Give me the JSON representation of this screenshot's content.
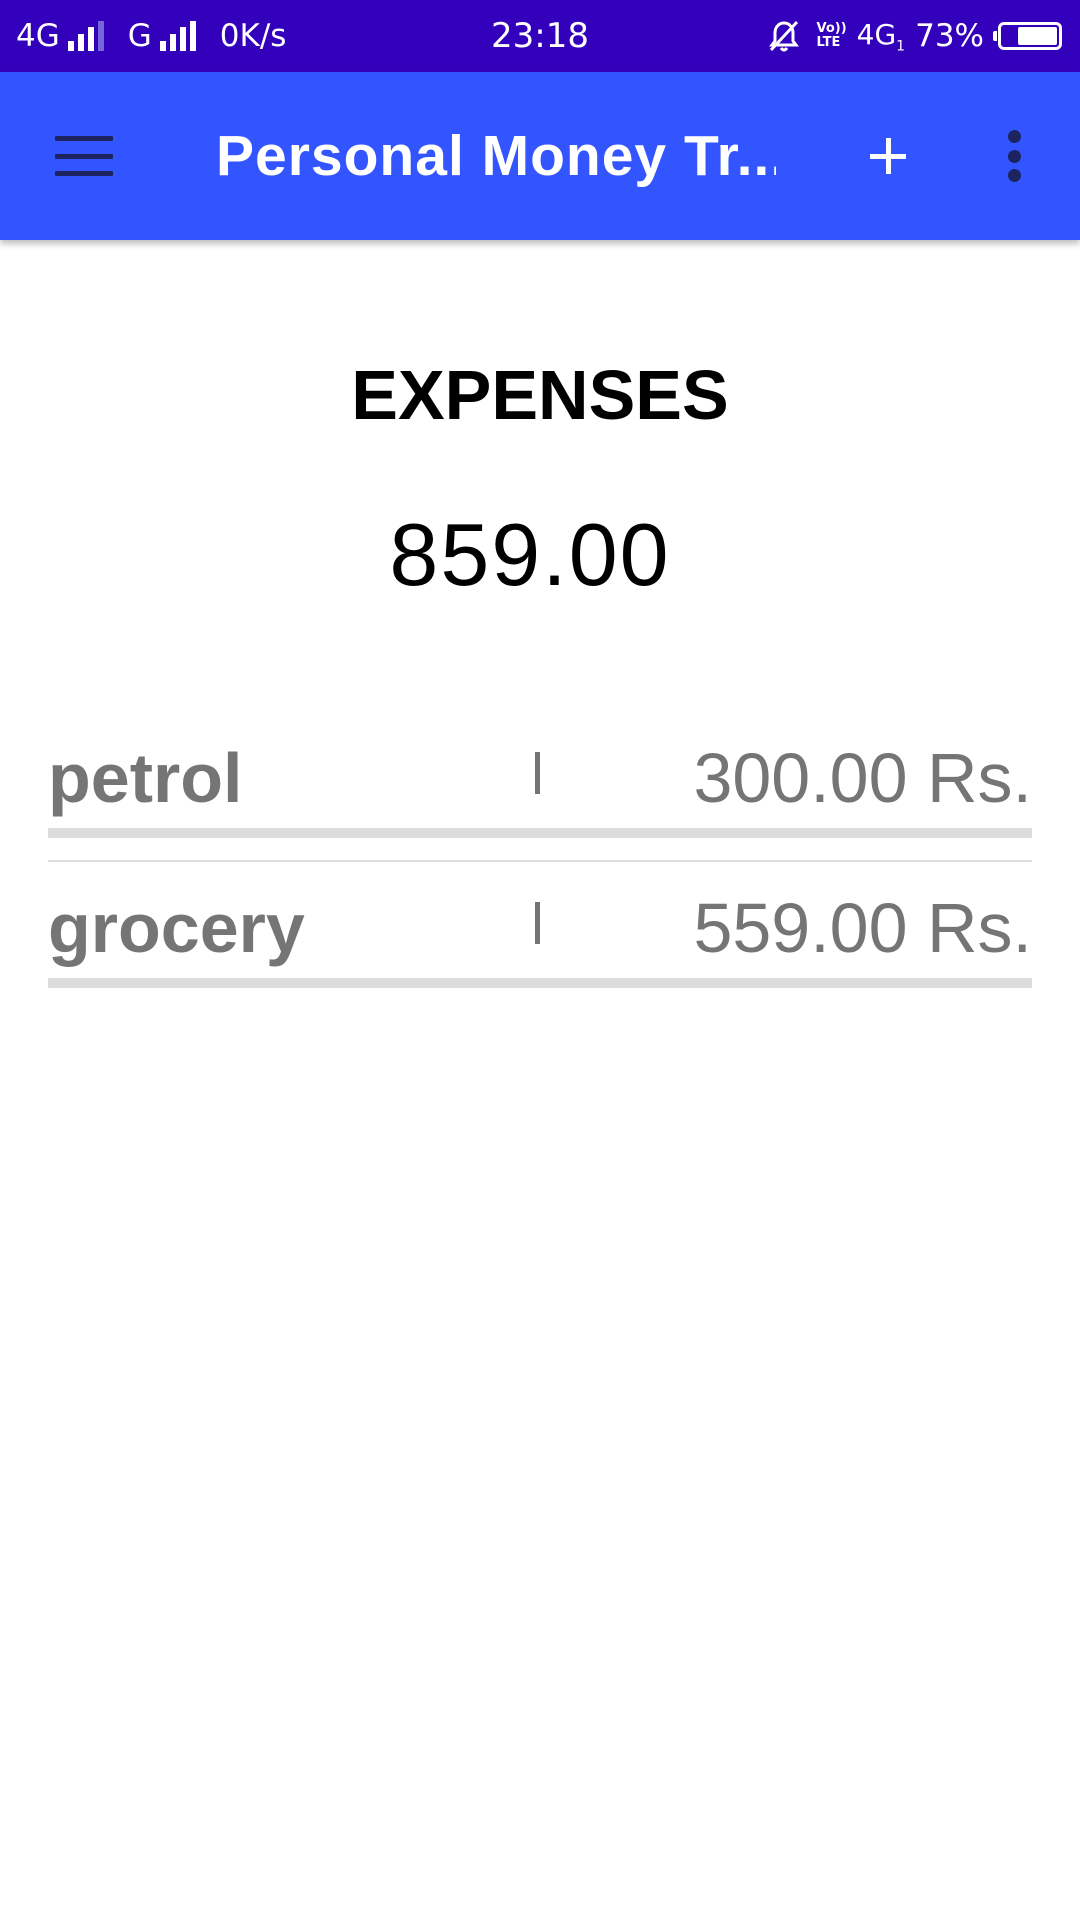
{
  "status_bar": {
    "net1_label": "4G",
    "net2_label": "G",
    "speed": "0K/s",
    "time": "23:18",
    "volte_top": "Vo))",
    "volte_bottom": "LTE",
    "net4g": "4G",
    "net4g_sub": "1",
    "battery_percent": "73%",
    "battery_level": 0.73,
    "icons": [
      "signal-icon",
      "bell-off-icon",
      "volte-icon",
      "battery-icon"
    ]
  },
  "app_bar": {
    "title": "Personal Money Tr...",
    "menu_icon": "hamburger-icon",
    "add_icon": "plus-icon",
    "overflow_icon": "overflow-icon"
  },
  "summary": {
    "heading": "EXPENSES",
    "total": "859.00"
  },
  "expenses": [
    {
      "name": "petrol",
      "separator": "|",
      "amount": "300.00 Rs."
    },
    {
      "name": "grocery",
      "separator": "|",
      "amount": "559.00 Rs."
    }
  ],
  "colors": {
    "status_bar": "#3300bb",
    "app_bar": "#3355ff",
    "row_text": "#757575",
    "row_underline": "#dcdcdc"
  }
}
